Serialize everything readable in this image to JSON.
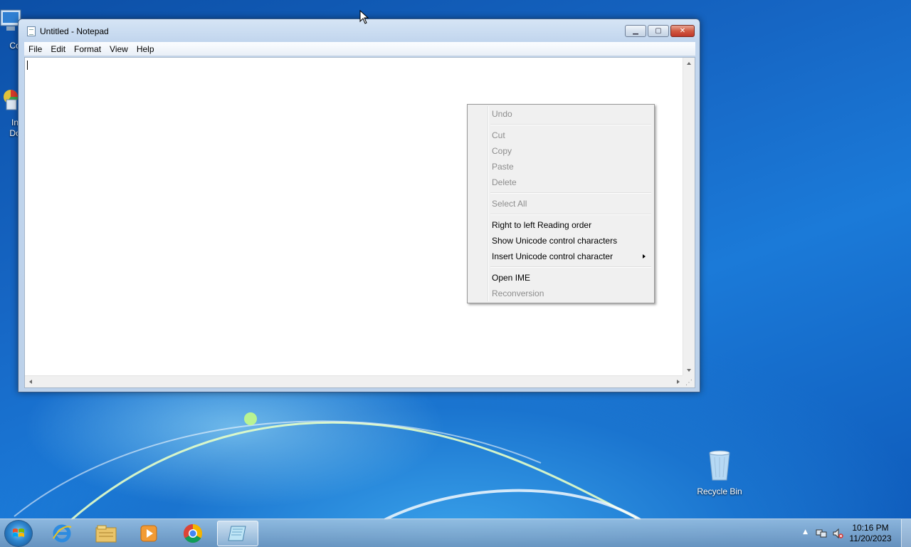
{
  "desktop": {
    "icons": [
      {
        "label": "Co",
        "icon": "computer-icon"
      },
      {
        "label": "In Do",
        "icon": "installer-icon"
      },
      {
        "label": "Recycle Bin",
        "icon": "recycle-bin-icon"
      }
    ]
  },
  "window": {
    "title": "Untitled - Notepad",
    "menu": [
      "File",
      "Edit",
      "Format",
      "View",
      "Help"
    ]
  },
  "context_menu": {
    "items": [
      {
        "label": "Undo",
        "enabled": false
      },
      {
        "label": "Cut",
        "enabled": false
      },
      {
        "label": "Copy",
        "enabled": false
      },
      {
        "label": "Paste",
        "enabled": false
      },
      {
        "label": "Delete",
        "enabled": false
      },
      {
        "label": "Select All",
        "enabled": false
      },
      {
        "label": "Right to left Reading order",
        "enabled": true
      },
      {
        "label": "Show Unicode control characters",
        "enabled": true
      },
      {
        "label": "Insert Unicode control character",
        "enabled": true,
        "submenu": true
      },
      {
        "label": "Open IME",
        "enabled": true
      },
      {
        "label": "Reconversion",
        "enabled": false
      }
    ]
  },
  "taskbar": {
    "pinned": [
      "internet-explorer-icon",
      "file-explorer-icon",
      "media-player-icon",
      "chrome-icon",
      "notepad-icon"
    ],
    "active": "notepad-icon",
    "clock": {
      "time": "10:16 PM",
      "date": "11/20/2023"
    }
  }
}
